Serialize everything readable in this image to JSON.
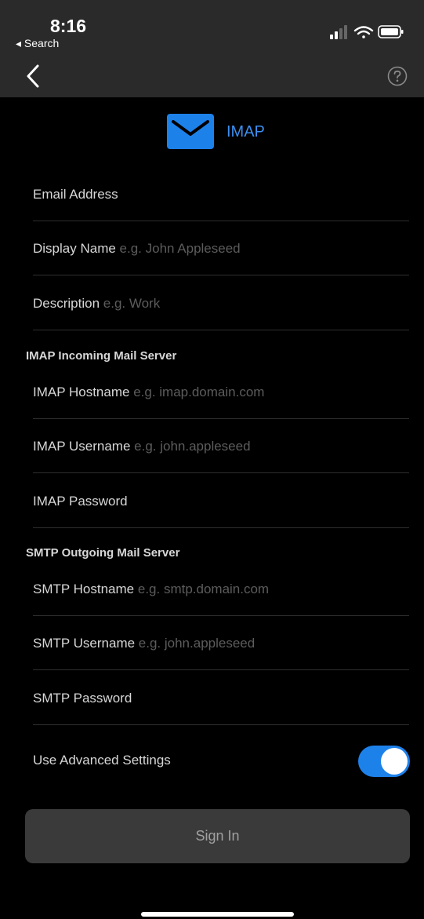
{
  "status": {
    "time": "8:16",
    "back_app": "◂ Search"
  },
  "header": {
    "title": "IMAP"
  },
  "colors": {
    "accent": "#1d81ea",
    "background": "#000000",
    "topbar": "#2a2a2a",
    "placeholder": "#5c5c5c"
  },
  "account": {
    "email_label": "Email Address",
    "display_name_label": "Display Name",
    "display_name_placeholder": "e.g. John Appleseed",
    "description_label": "Description",
    "description_placeholder": "e.g. Work"
  },
  "incoming": {
    "section_title": "IMAP Incoming Mail Server",
    "hostname_label": "IMAP Hostname",
    "hostname_placeholder": "e.g. imap.domain.com",
    "username_label": "IMAP Username",
    "username_placeholder": "e.g. john.appleseed",
    "password_label": "IMAP Password"
  },
  "outgoing": {
    "section_title": "SMTP Outgoing Mail Server",
    "hostname_label": "SMTP Hostname",
    "hostname_placeholder": "e.g. smtp.domain.com",
    "username_label": "SMTP Username",
    "username_placeholder": "e.g. john.appleseed",
    "password_label": "SMTP Password"
  },
  "advanced": {
    "label": "Use Advanced Settings",
    "enabled": true
  },
  "actions": {
    "sign_in": "Sign In"
  },
  "icons": {
    "back": "chevron-left-icon",
    "help": "question-circle-icon",
    "mail": "envelope-icon"
  }
}
